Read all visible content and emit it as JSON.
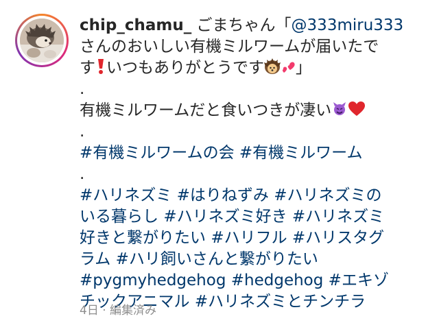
{
  "post": {
    "username": "chip_chamu_",
    "lines": [
      {
        "segments": [
          {
            "type": "text",
            "text": "ごまちゃん「"
          },
          {
            "type": "mention",
            "text": "@333miru333"
          }
        ]
      },
      {
        "segments": [
          {
            "type": "text",
            "text": "さんのおいしい有機ミルワームが届いたで"
          }
        ]
      },
      {
        "segments": [
          {
            "type": "text",
            "text": "す"
          },
          {
            "type": "emoji",
            "name": "red-exclamation-icon"
          },
          {
            "type": "text",
            "text": "いつもありがとうです"
          },
          {
            "type": "emoji",
            "name": "hedgehog-icon"
          },
          {
            "type": "emoji",
            "name": "two-hearts-icon"
          },
          {
            "type": "text",
            "text": "」"
          }
        ]
      },
      {
        "segments": [
          {
            "type": "text",
            "text": "."
          }
        ]
      },
      {
        "segments": [
          {
            "type": "text",
            "text": "有機ミルワームだと食いつきが凄い"
          },
          {
            "type": "emoji",
            "name": "smiling-devil-icon"
          },
          {
            "type": "emoji",
            "name": "red-heart-icon"
          }
        ]
      },
      {
        "segments": [
          {
            "type": "text",
            "text": "."
          }
        ]
      },
      {
        "segments": [
          {
            "type": "hashtag",
            "text": "#有機ミルワームの会"
          },
          {
            "type": "text",
            "text": " "
          },
          {
            "type": "hashtag",
            "text": "#有機ミルワーム"
          }
        ]
      },
      {
        "segments": [
          {
            "type": "text",
            "text": "."
          }
        ]
      },
      {
        "segments": [
          {
            "type": "text",
            "text": " "
          },
          {
            "type": "hashtag",
            "text": "#ハリネズミ"
          },
          {
            "type": "text",
            "text": " "
          },
          {
            "type": "hashtag",
            "text": "#はりねずみ"
          },
          {
            "type": "text",
            "text": " "
          },
          {
            "type": "hashtag",
            "text": "#ハリネズミの"
          }
        ]
      },
      {
        "segments": [
          {
            "type": "hashtag",
            "text": "いる暮らし"
          },
          {
            "type": "text",
            "text": " "
          },
          {
            "type": "hashtag",
            "text": "#ハリネズミ好き"
          },
          {
            "type": "text",
            "text": " "
          },
          {
            "type": "hashtag",
            "text": "#ハリネズミ"
          }
        ]
      },
      {
        "segments": [
          {
            "type": "hashtag",
            "text": "好きと繋がりたい"
          },
          {
            "type": "text",
            "text": " "
          },
          {
            "type": "hashtag",
            "text": "#ハリフル"
          },
          {
            "type": "text",
            "text": " "
          },
          {
            "type": "hashtag",
            "text": "#ハリスタグ"
          }
        ]
      },
      {
        "segments": [
          {
            "type": "hashtag",
            "text": "ラム"
          },
          {
            "type": "text",
            "text": " "
          },
          {
            "type": "hashtag",
            "text": "#ハリ飼いさんと繋がりたい"
          }
        ]
      },
      {
        "segments": [
          {
            "type": "hashtag",
            "text": "#pygmyhedgehog"
          },
          {
            "type": "text",
            "text": " "
          },
          {
            "type": "hashtag",
            "text": "#hedgehog"
          },
          {
            "type": "text",
            "text": " "
          },
          {
            "type": "hashtag",
            "text": "#エキゾ"
          }
        ]
      },
      {
        "segments": [
          {
            "type": "hashtag",
            "text": "チックアニマル"
          },
          {
            "type": "text",
            "text": " "
          },
          {
            "type": "hashtag",
            "text": "#ハリネズミとチンチラ"
          }
        ]
      }
    ],
    "timestamp": "4日",
    "separator": "·",
    "edited_label": "編集済み"
  },
  "colors": {
    "text": "#262626",
    "link": "#00376b",
    "meta": "#8e8e8e",
    "ring_start": "#f58529",
    "ring_mid": "#dd2a7b",
    "ring_end": "#8134af"
  }
}
